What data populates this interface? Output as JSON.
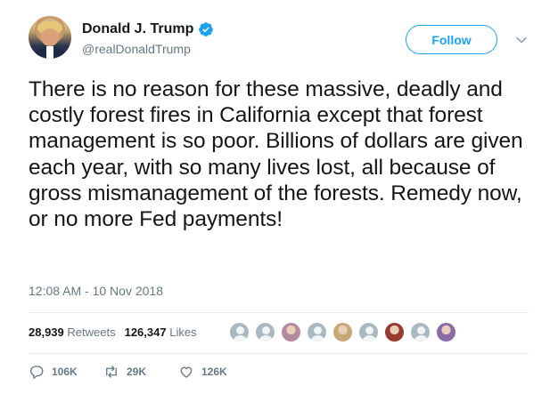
{
  "user": {
    "display_name": "Donald J. Trump",
    "handle": "@realDonaldTrump",
    "verified_icon": "verified-badge-icon"
  },
  "header": {
    "follow_label": "Follow",
    "caret_icon": "chevron-down-icon"
  },
  "tweet": {
    "text": "There is no reason for these massive, deadly and costly forest fires in California except that forest management is so poor. Billions of dollars are given each year, with so many lives lost, all because of gross mismanagement of the forests. Remedy now, or no more Fed payments!",
    "timestamp": "12:08 AM - 10 Nov 2018"
  },
  "stats": {
    "retweets_count": "28,939",
    "retweets_label": "Retweets",
    "likes_count": "126,347",
    "likes_label": "Likes"
  },
  "likers": [
    {
      "type": "default",
      "color": "#aab8c2"
    },
    {
      "type": "default",
      "color": "#aab8c2"
    },
    {
      "type": "photo",
      "color": "#b58aa0"
    },
    {
      "type": "default",
      "color": "#aab8c2"
    },
    {
      "type": "photo",
      "color": "#c9a878"
    },
    {
      "type": "default",
      "color": "#aab8c2"
    },
    {
      "type": "photo",
      "color": "#9a3b2f"
    },
    {
      "type": "default",
      "color": "#aab8c2"
    },
    {
      "type": "photo",
      "color": "#8c6aa8"
    }
  ],
  "actions": {
    "reply_count": "106K",
    "retweet_count": "29K",
    "like_count": "126K"
  },
  "colors": {
    "accent": "#1da1f2",
    "muted": "#657786",
    "text": "#14171a",
    "divider": "#e6ecf0"
  }
}
